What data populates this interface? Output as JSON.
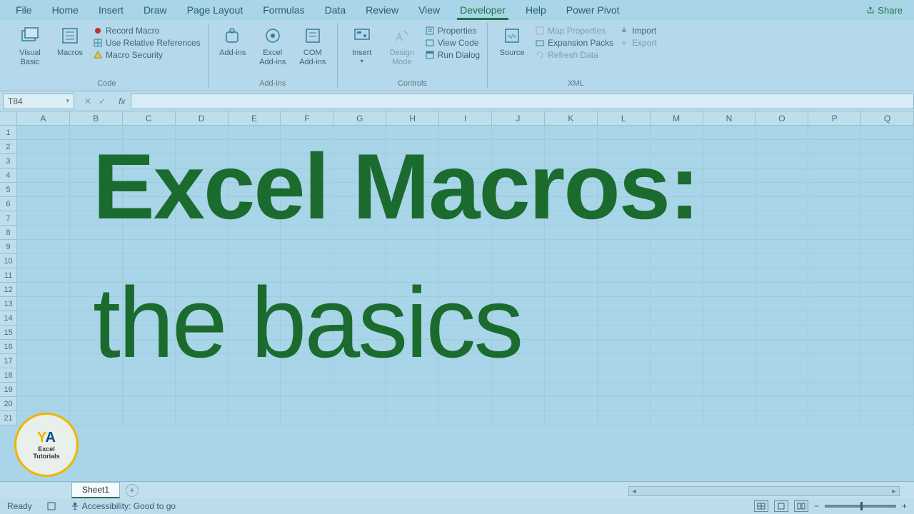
{
  "menu": {
    "items": [
      "File",
      "Home",
      "Insert",
      "Draw",
      "Page Layout",
      "Formulas",
      "Data",
      "Review",
      "View",
      "Developer",
      "Help",
      "Power Pivot"
    ],
    "active": "Developer",
    "share": "Share"
  },
  "ribbon": {
    "code": {
      "label": "Code",
      "visual_basic": "Visual Basic",
      "macros": "Macros",
      "record_macro": "Record Macro",
      "use_relative": "Use Relative References",
      "macro_security": "Macro Security"
    },
    "addins": {
      "label": "Add-ins",
      "addins": "Add-ins",
      "excel_addins": "Excel Add-ins",
      "com_addins": "COM Add-ins"
    },
    "controls": {
      "label": "Controls",
      "insert": "Insert",
      "design_mode": "Design Mode",
      "properties": "Properties",
      "view_code": "View Code",
      "run_dialog": "Run Dialog"
    },
    "xml": {
      "label": "XML",
      "source": "Source",
      "map_properties": "Map Properties",
      "expansion_packs": "Expansion Packs",
      "refresh_data": "Refresh Data",
      "import": "Import",
      "export": "Export"
    }
  },
  "name_box": "T84",
  "columns": [
    "A",
    "B",
    "C",
    "D",
    "E",
    "F",
    "G",
    "H",
    "I",
    "J",
    "K",
    "L",
    "M",
    "N",
    "O",
    "P",
    "Q"
  ],
  "rows": [
    "1",
    "2",
    "3",
    "4",
    "5",
    "6",
    "7",
    "8",
    "9",
    "10",
    "11",
    "12",
    "13",
    "14",
    "15",
    "16",
    "17",
    "18",
    "19",
    "20",
    "21"
  ],
  "overlay": {
    "title": "Excel Macros:",
    "subtitle": "the basics"
  },
  "badge": {
    "initials_y": "Y",
    "initials_a": "A",
    "line1": "Excel",
    "line2": "Tutorials"
  },
  "sheet": {
    "active": "Sheet1",
    "add": "+"
  },
  "status": {
    "ready": "Ready",
    "accessibility": "Accessibility: Good to go",
    "zoom_minus": "−",
    "zoom_plus": "+"
  }
}
